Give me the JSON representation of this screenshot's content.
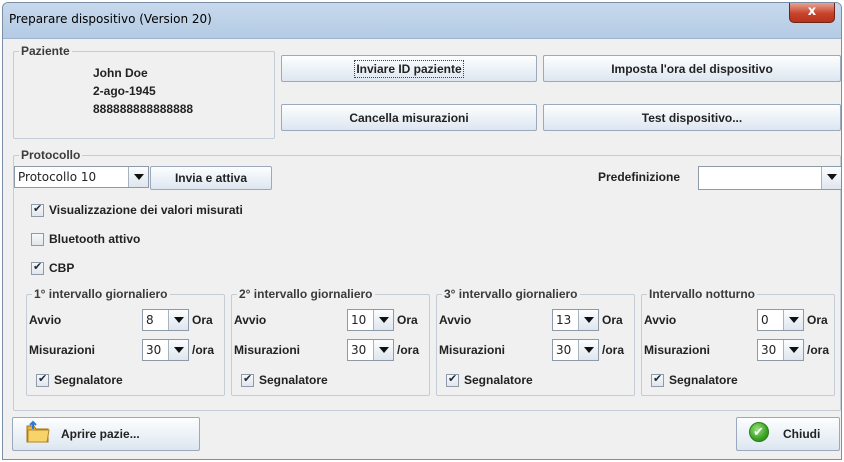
{
  "window": {
    "title": "Preparare dispositivo (Version 20)",
    "close_label": "x"
  },
  "patient": {
    "legend": "Paziente",
    "name": "John Doe",
    "dob": "2-ago-1945",
    "id": "888888888888888"
  },
  "top_buttons": {
    "send_id": "Inviare ID paziente",
    "set_time": "Imposta l'ora del dispositivo",
    "clear_measurements": "Cancella misurazioni",
    "test_device": "Test dispositivo..."
  },
  "protocol": {
    "legend": "Protocollo",
    "selected": "Protocollo 10",
    "send_activate": "Invia e attiva",
    "preset_label": "Predefinizione",
    "preset_value": "",
    "options": [
      {
        "label": "Visualizzazione dei valori misurati",
        "checked": true
      },
      {
        "label": "Bluetooth attivo",
        "checked": false
      },
      {
        "label": "CBP",
        "checked": true
      }
    ],
    "intervals": [
      {
        "legend": "1° intervallo giornaliero",
        "start_label": "Avvio",
        "start": "8",
        "start_unit": "Ora",
        "meas_label": "Misurazioni",
        "meas": "30",
        "meas_unit": "/ora",
        "marker_label": "Segnalatore",
        "marker": true
      },
      {
        "legend": "2° intervallo giornaliero",
        "start_label": "Avvio",
        "start": "10",
        "start_unit": "Ora",
        "meas_label": "Misurazioni",
        "meas": "30",
        "meas_unit": "/ora",
        "marker_label": "Segnalatore",
        "marker": true
      },
      {
        "legend": "3° intervallo giornaliero",
        "start_label": "Avvio",
        "start": "13",
        "start_unit": "Ora",
        "meas_label": "Misurazioni",
        "meas": "30",
        "meas_unit": "/ora",
        "marker_label": "Segnalatore",
        "marker": true
      },
      {
        "legend": "Intervallo notturno",
        "start_label": "Avvio",
        "start": "0",
        "start_unit": "Ora",
        "meas_label": "Misurazioni",
        "meas": "30",
        "meas_unit": "/ora",
        "marker_label": "Segnalatore",
        "marker": true
      }
    ]
  },
  "footer": {
    "open_patient": "Aprire pazie...",
    "close": "Chiudi"
  }
}
